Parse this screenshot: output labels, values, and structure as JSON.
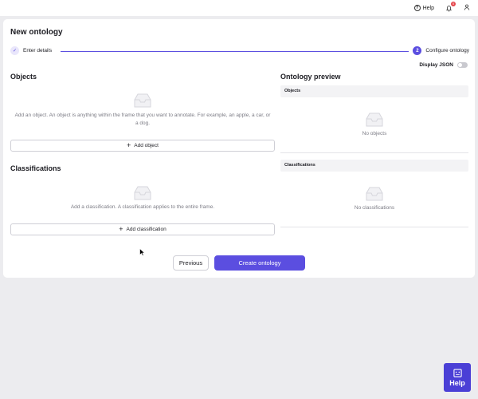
{
  "topbar": {
    "help_label": "Help",
    "notification_count": "0",
    "icons": [
      "help-circle-icon",
      "bell-icon",
      "user-icon"
    ]
  },
  "page": {
    "title": "New ontology"
  },
  "stepper": {
    "steps": [
      {
        "number": "1",
        "label": "Enter details",
        "status": "done"
      },
      {
        "number": "2",
        "label": "Configure ontology",
        "status": "active"
      }
    ]
  },
  "json_toggle": {
    "label": "Display JSON",
    "on": false
  },
  "objects": {
    "title": "Objects",
    "empty_text": "Add an object. An object is anything within the frame that you want to annotate. For example, an apple, a car, or a dog.",
    "add_label": "Add object"
  },
  "classifications": {
    "title": "Classifications",
    "empty_text": "Add a classification. A classification applies to the entire frame.",
    "add_label": "Add classification"
  },
  "preview": {
    "title": "Ontology preview",
    "objects_header": "Objects",
    "objects_empty": "No objects",
    "classifications_header": "Classifications",
    "classifications_empty": "No classifications"
  },
  "footer": {
    "previous_label": "Previous",
    "create_label": "Create ontology"
  },
  "help_widget": {
    "label": "Help"
  },
  "colors": {
    "accent": "#5b4ee0",
    "help_widget": "#4a3fd6",
    "badge": "#e5484d",
    "background": "#ececef"
  }
}
